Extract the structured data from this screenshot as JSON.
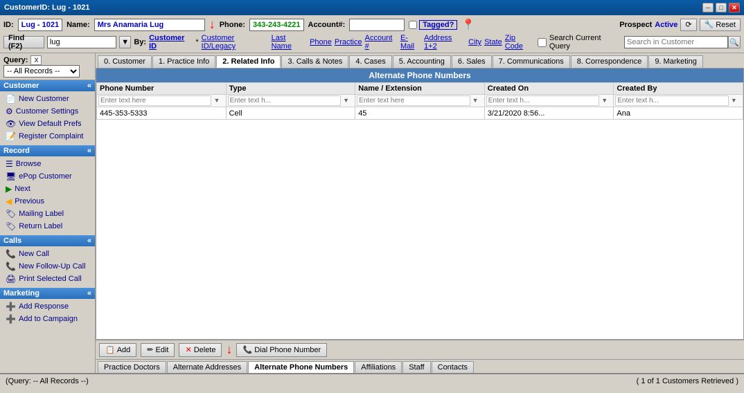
{
  "titlebar": {
    "title": "CustomerID: Lug - 1021",
    "min_btn": "─",
    "max_btn": "□",
    "close_btn": "✕"
  },
  "header": {
    "id_label": "ID:",
    "id_value": "Lug - 1021",
    "name_label": "Name:",
    "name_value": "Mrs Anamaria Lug",
    "phone_label": "Phone:",
    "phone_value": "343-243-4221",
    "account_label": "Account#:",
    "tagged_label": "Tagged?",
    "prospect_label": "Prospect",
    "prospect_value": "Active",
    "refresh_label": "⟳",
    "reset_label": "Reset"
  },
  "find": {
    "label": "Find (F2)",
    "value": "lug",
    "by_label": "By:",
    "by_options": [
      "Customer ID",
      "Customer ID/Legacy",
      "Last Name",
      "Phone",
      "Practice",
      "Account #",
      "E-Mail",
      "Address 1+2",
      "City",
      "State",
      "Zip Code"
    ],
    "search_current_query": "Search Current Query",
    "search_placeholder": "Search in Customer"
  },
  "nav_links": [
    {
      "label": "* Customer ID/Legacy",
      "active": false
    },
    {
      "label": "Last Name",
      "active": false
    },
    {
      "label": "Phone",
      "active": false
    },
    {
      "label": "Practice",
      "active": false
    },
    {
      "label": "Account #",
      "active": false
    },
    {
      "label": "E-Mail",
      "active": false
    },
    {
      "label": "Address 1+2",
      "active": false
    },
    {
      "label": "City",
      "active": false
    },
    {
      "label": "State",
      "active": false
    },
    {
      "label": "Zip Code",
      "active": false
    }
  ],
  "sidebar": {
    "query_label": "Query:",
    "query_value": "-- All Records --",
    "customer_section": "Customer",
    "customer_items": [
      {
        "icon": "📄",
        "label": "New Customer"
      },
      {
        "icon": "⚙",
        "label": "Customer Settings"
      },
      {
        "icon": "👁",
        "label": "View Default Prefs"
      },
      {
        "icon": "📝",
        "label": "Register Complaint"
      }
    ],
    "record_section": "Record",
    "record_items": [
      {
        "icon": "☰",
        "label": "Browse"
      },
      {
        "icon": "🖥",
        "label": "ePop Customer"
      },
      {
        "icon": "▶",
        "label": "Next"
      },
      {
        "icon": "◀",
        "label": "Previous"
      },
      {
        "icon": "🏷",
        "label": "Mailing Label"
      },
      {
        "icon": "🏷",
        "label": "Return Label"
      }
    ],
    "calls_section": "Calls",
    "calls_items": [
      {
        "icon": "📞",
        "label": "New Call"
      },
      {
        "icon": "📞",
        "label": "New Follow-Up Call"
      },
      {
        "icon": "🖨",
        "label": "Print Selected Call"
      }
    ],
    "marketing_section": "Marketing",
    "marketing_items": [
      {
        "icon": "➕",
        "label": "Add Response"
      },
      {
        "icon": "➕",
        "label": "Add to Campaign"
      }
    ]
  },
  "tabs": [
    {
      "label": "0. Customer",
      "active": false
    },
    {
      "label": "1. Practice Info",
      "active": false
    },
    {
      "label": "2. Related Info",
      "active": true
    },
    {
      "label": "3. Calls & Notes",
      "active": false
    },
    {
      "label": "4. Cases",
      "active": false
    },
    {
      "label": "5. Accounting",
      "active": false
    },
    {
      "label": "6. Sales",
      "active": false
    },
    {
      "label": "7. Communications",
      "active": false
    },
    {
      "label": "8. Correspondence",
      "active": false
    },
    {
      "label": "9. Marketing",
      "active": false
    }
  ],
  "table": {
    "section_title": "Alternate Phone Numbers",
    "columns": [
      "Phone Number",
      "Type",
      "Name / Extension",
      "Created On",
      "Created By"
    ],
    "filters": [
      "Enter text here",
      "Enter text h...",
      "Enter text here",
      "Enter text h...",
      "Enter text h..."
    ],
    "rows": [
      {
        "phone": "445-353-5333",
        "type": "Cell",
        "name_ext": "45",
        "created_on": "3/21/2020 8:56...",
        "created_by": "Ana"
      }
    ]
  },
  "action_buttons": [
    {
      "icon": "📋",
      "label": "Add"
    },
    {
      "icon": "✏",
      "label": "Edit"
    },
    {
      "icon": "✕",
      "label": "Delete"
    },
    {
      "icon": "📞",
      "label": "Dial Phone Number"
    }
  ],
  "sub_tabs": [
    {
      "label": "Practice Doctors",
      "active": false
    },
    {
      "label": "Alternate Addresses",
      "active": false
    },
    {
      "label": "Alternate Phone Numbers",
      "active": true
    },
    {
      "label": "Affiliations",
      "active": false
    },
    {
      "label": "Staff",
      "active": false
    },
    {
      "label": "Contacts",
      "active": false
    }
  ],
  "status_bar": {
    "left": "(Query: -- All Records --)",
    "right": "( 1 of 1 Customers Retrieved )"
  }
}
